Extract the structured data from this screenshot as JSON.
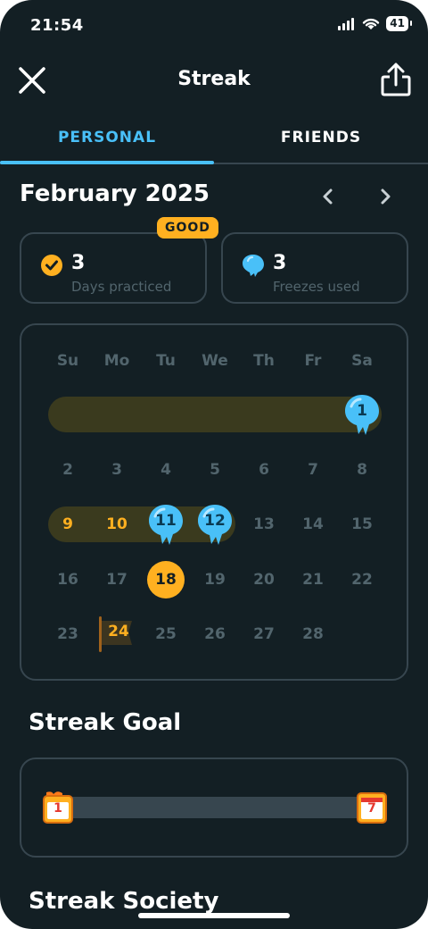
{
  "status_bar": {
    "time": "21:54",
    "battery": "41"
  },
  "header": {
    "title": "Streak"
  },
  "tabs": [
    {
      "label": "PERSONAL",
      "active": true
    },
    {
      "label": "FRIENDS",
      "active": false
    }
  ],
  "month": {
    "label": "February 2025"
  },
  "stats": {
    "badge": "GOOD",
    "days_practiced": {
      "value": "3",
      "label": "Days practiced"
    },
    "freezes_used": {
      "value": "3",
      "label": "Freezes used"
    }
  },
  "calendar": {
    "weekdays": [
      "Su",
      "Mo",
      "Tu",
      "We",
      "Th",
      "Fr",
      "Sa"
    ],
    "days": {
      "d1": "1",
      "d2": "2",
      "d3": "3",
      "d4": "4",
      "d5": "5",
      "d6": "6",
      "d7": "7",
      "d8": "8",
      "d9": "9",
      "d10": "10",
      "d11": "11",
      "d12": "12",
      "d13": "13",
      "d14": "14",
      "d15": "15",
      "d16": "16",
      "d17": "17",
      "d18": "18",
      "d19": "19",
      "d20": "20",
      "d21": "21",
      "d22": "22",
      "d23": "23",
      "d24": "24",
      "d25": "25",
      "d26": "26",
      "d27": "27",
      "d28": "28"
    }
  },
  "streak_goal": {
    "title": "Streak Goal",
    "start_day": "1",
    "end_day": "7"
  },
  "streak_society": {
    "title": "Streak Society"
  },
  "colors": {
    "background": "#131f24",
    "accent_blue": "#49c0f8",
    "accent_orange": "#ffb020",
    "border": "#37464f",
    "muted": "#52656d"
  },
  "icons": [
    "close-icon",
    "share-icon",
    "chevron-left-icon",
    "chevron-right-icon",
    "checkmark-icon",
    "freeze-icon",
    "flag-icon",
    "calendar-icon"
  ]
}
